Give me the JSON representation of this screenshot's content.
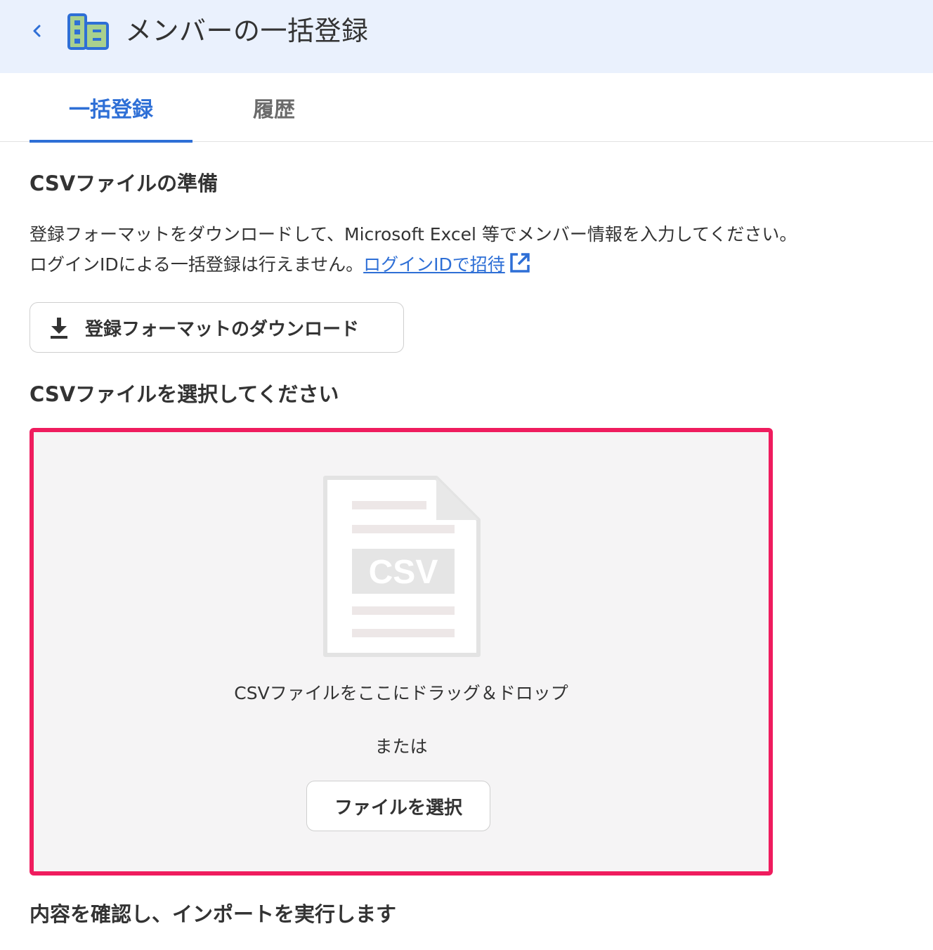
{
  "header": {
    "title": "メンバーの一括登録",
    "back_icon": "chevron-left-icon",
    "app_icon": "building-icon",
    "colors": {
      "background": "#eaf1fd",
      "icon_fill": "#a9d08e",
      "icon_stroke": "#2e6fd6",
      "back": "#2e6fd6"
    }
  },
  "tabs": [
    {
      "label": "一括登録",
      "active": true
    },
    {
      "label": "履歴",
      "active": false
    }
  ],
  "prepare": {
    "title": "CSVファイルの準備",
    "line1": "登録フォーマットをダウンロードして、Microsoft Excel 等でメンバー情報を入力してください。",
    "line2": "ログインIDによる一括登録は行えません。",
    "link_label": "ログインIDで招待",
    "link_icon": "external-link-icon",
    "download_button": {
      "label": "登録フォーマットのダウンロード",
      "icon": "download-icon"
    }
  },
  "select": {
    "title": "CSVファイルを選択してください",
    "dropzone": {
      "file_icon": "csv-file-icon",
      "file_icon_label": "CSV",
      "drop_text": "CSVファイルをここにドラッグ＆ドロップ",
      "or_text": "または",
      "select_button_label": "ファイルを選択",
      "border_color": "#ef1c5e"
    }
  },
  "confirm": {
    "title": "内容を確認し、インポートを実行します"
  },
  "colors": {
    "accent": "#2e6fd6",
    "text": "#333333"
  }
}
